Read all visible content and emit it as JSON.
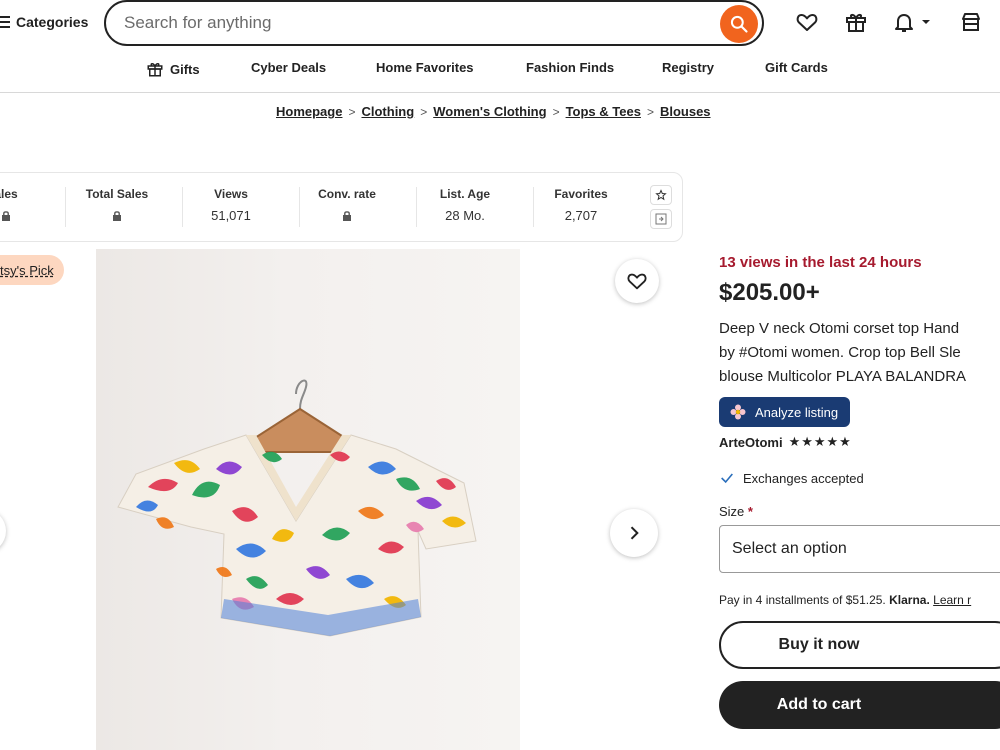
{
  "header": {
    "categories_label": "Categories",
    "search_placeholder": "Search for anything"
  },
  "nav": {
    "items": [
      {
        "label": "Gifts",
        "icon": "gift-icon"
      },
      {
        "label": "Cyber Deals"
      },
      {
        "label": "Home Favorites"
      },
      {
        "label": "Fashion Finds"
      },
      {
        "label": "Registry"
      },
      {
        "label": "Gift Cards"
      }
    ]
  },
  "breadcrumb": [
    "Homepage",
    "Clothing",
    "Women's Clothing",
    "Tops & Tees",
    "Blouses"
  ],
  "stats": [
    {
      "label": "ales",
      "value": "",
      "locked": true
    },
    {
      "label": "Total Sales",
      "value": "",
      "locked": true
    },
    {
      "label": "Views",
      "value": "51,071",
      "locked": false
    },
    {
      "label": "Conv. rate",
      "value": "",
      "locked": true
    },
    {
      "label": "List. Age",
      "value": "28 Mo.",
      "locked": false
    },
    {
      "label": "Favorites",
      "value": "2,707",
      "locked": false
    }
  ],
  "badge": {
    "label": "tsy's Pick"
  },
  "listing": {
    "views_24h": "13 views in the last 24 hours",
    "price": "$205.00+",
    "title_lines": [
      "Deep V neck Otomi corset top Hand",
      "by #Otomi women. Crop top Bell Sle",
      "blouse Multicolor PLAYA BALANDRA"
    ],
    "analyze_label": "Analyze listing",
    "seller": "ArteOtomi",
    "stars": "★★★★★",
    "rating": 5,
    "exchange_label": "Exchanges accepted",
    "size_label": "Size",
    "required_mark": "*",
    "size_placeholder": "Select an option",
    "installments_text": "Pay in 4 installments of $51.25.",
    "klarna": "Klarna.",
    "learn_more": "Learn r",
    "buy_now": "Buy it now",
    "add_to_cart": "Add to cart"
  },
  "colors": {
    "accent_orange": "#f1641e",
    "views_red": "#a61a2e",
    "analyze_blue": "#1a3b73",
    "badge_peach": "#fdd7c0"
  }
}
